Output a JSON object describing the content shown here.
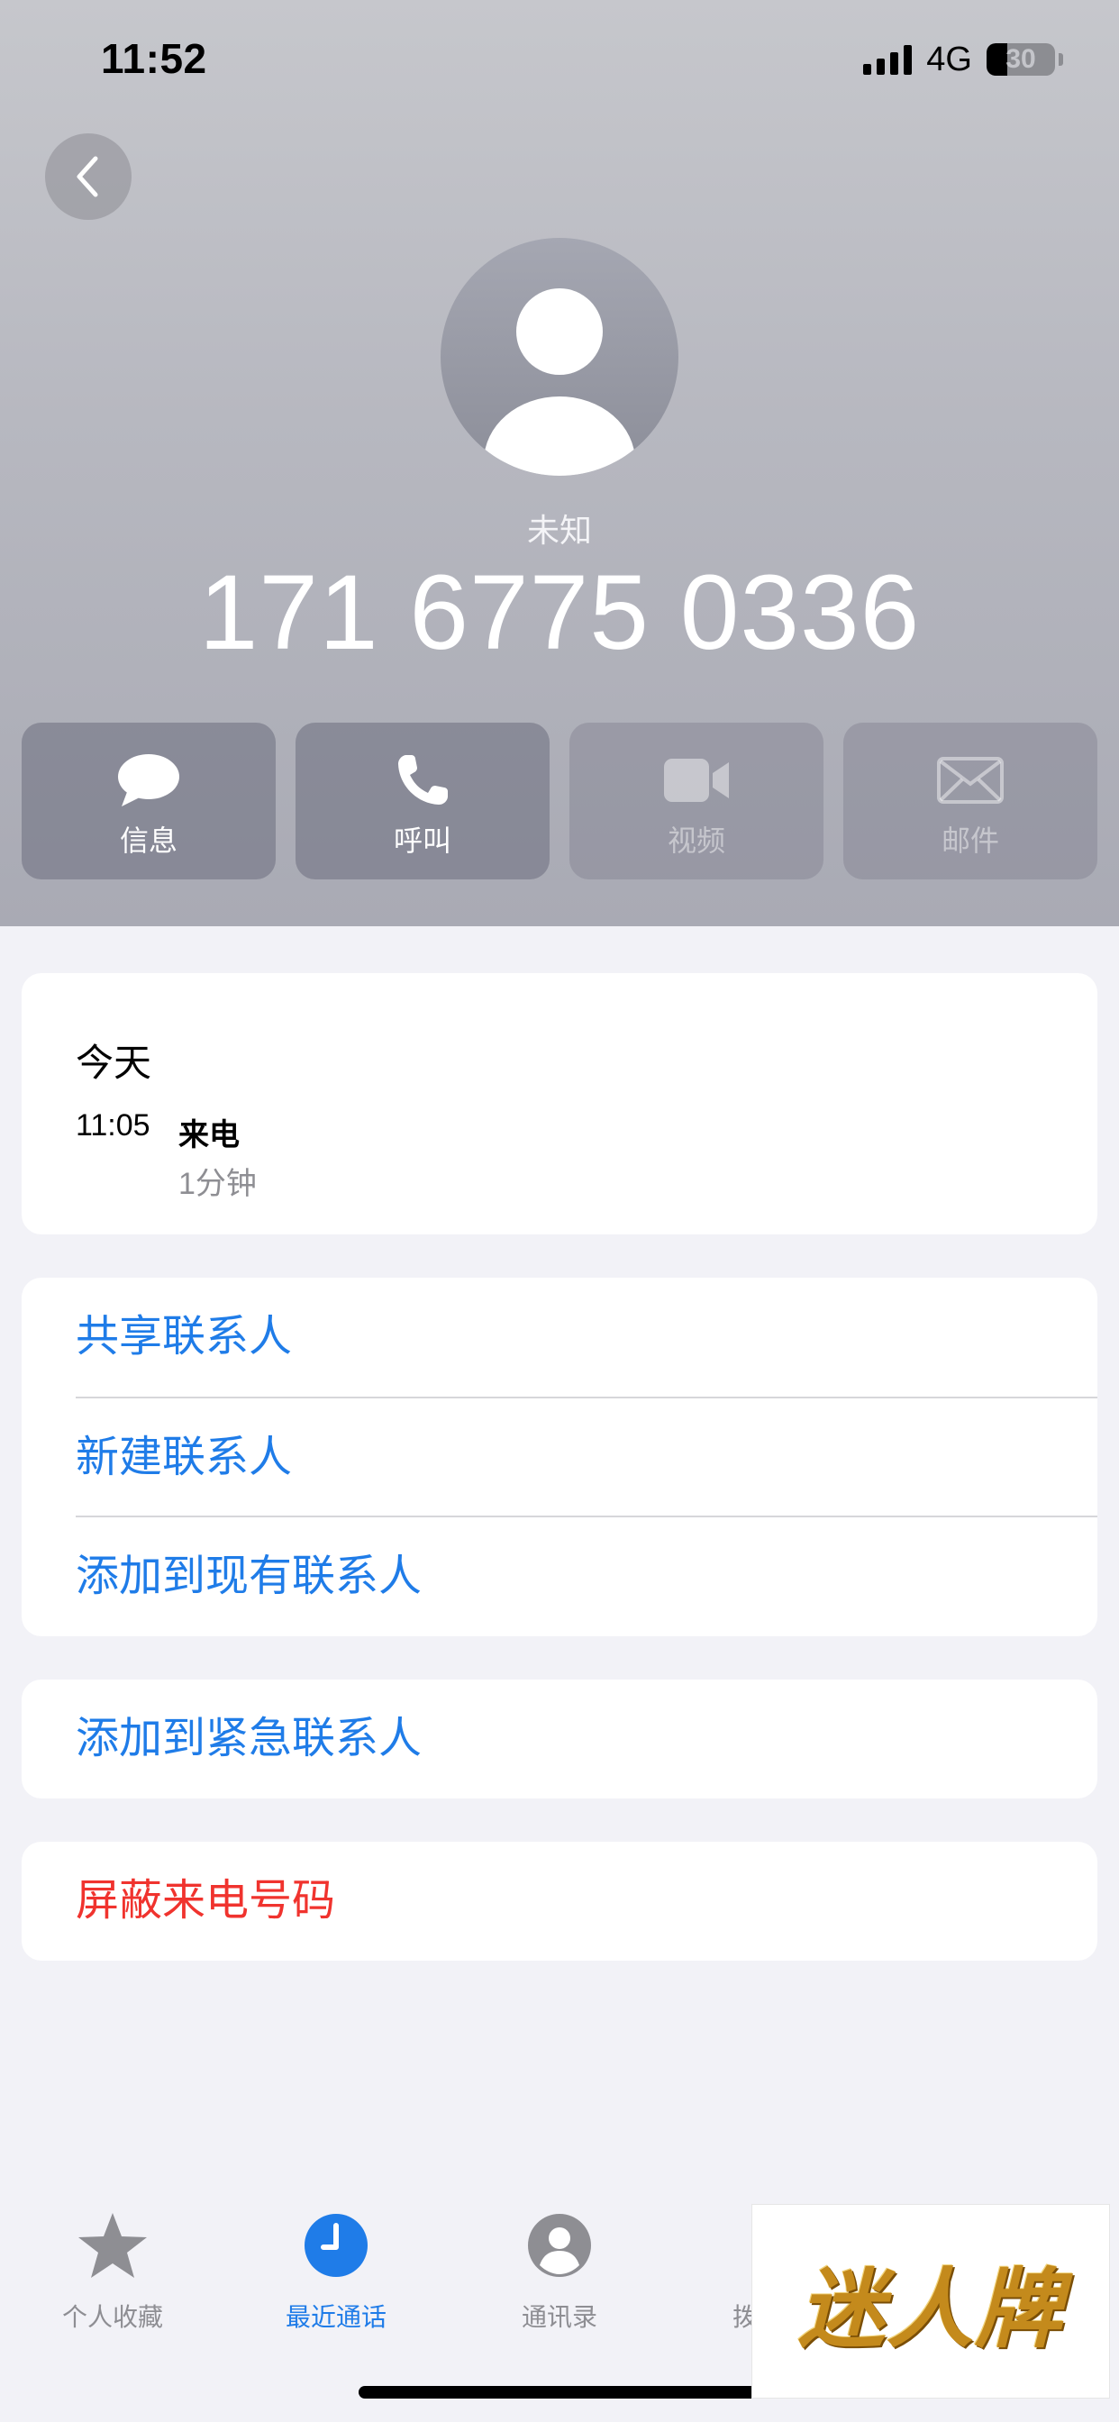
{
  "status_bar": {
    "time": "11:52",
    "network": "4G",
    "battery_level": "30",
    "battery_fraction": 0.3
  },
  "header": {
    "contact_label": "未知",
    "phone_number": "171 6775 0336"
  },
  "actions": [
    {
      "label": "信息",
      "icon": "message-bubble-icon",
      "enabled": true
    },
    {
      "label": "呼叫",
      "icon": "phone-icon",
      "enabled": true
    },
    {
      "label": "视频",
      "icon": "video-camera-icon",
      "enabled": false
    },
    {
      "label": "邮件",
      "icon": "envelope-icon",
      "enabled": false
    }
  ],
  "call_history": {
    "day": "今天",
    "entries": [
      {
        "time": "11:05",
        "type": "来电",
        "duration": "1分钟"
      }
    ]
  },
  "contact_menu": {
    "share": "共享联系人",
    "new_contact": "新建联系人",
    "add_existing": "添加到现有联系人"
  },
  "emergency_menu": {
    "add_emergency": "添加到紧急联系人"
  },
  "block_menu": {
    "block_caller": "屏蔽来电号码"
  },
  "tabbar": {
    "tabs": [
      {
        "label": "个人收藏",
        "icon": "star-icon",
        "active": false
      },
      {
        "label": "最近通话",
        "icon": "clock-icon",
        "active": true
      },
      {
        "label": "通讯录",
        "icon": "person-circle-icon",
        "active": false
      },
      {
        "label": "拨号键盘",
        "icon": "keypad-icon",
        "active": false
      }
    ]
  },
  "watermark": {
    "text": "迷人牌"
  },
  "colors": {
    "accent": "#1F7CE8",
    "danger": "#F0332E",
    "secondary_text": "#8E8E93",
    "background": "#F2F2F7"
  }
}
